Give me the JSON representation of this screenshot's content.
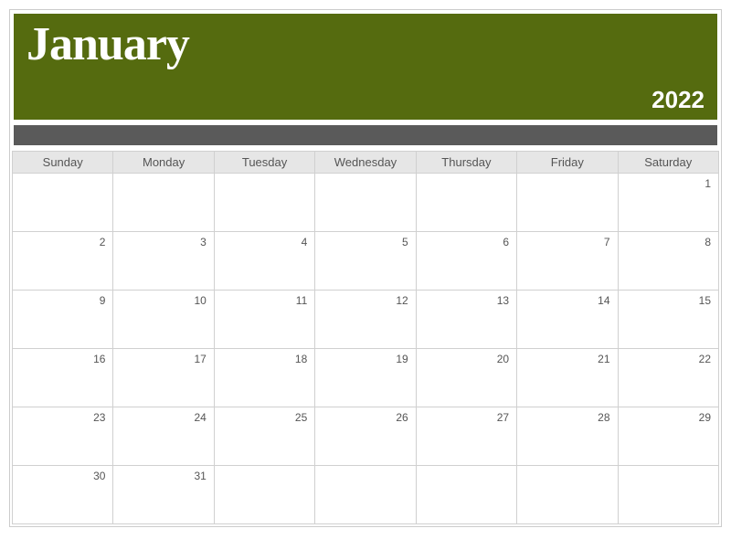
{
  "header": {
    "month": "January",
    "year": "2022"
  },
  "weekdays": [
    "Sunday",
    "Monday",
    "Tuesday",
    "Wednesday",
    "Thursday",
    "Friday",
    "Saturday"
  ],
  "weeks": [
    [
      "",
      "",
      "",
      "",
      "",
      "",
      "1"
    ],
    [
      "2",
      "3",
      "4",
      "5",
      "6",
      "7",
      "8"
    ],
    [
      "9",
      "10",
      "11",
      "12",
      "13",
      "14",
      "15"
    ],
    [
      "16",
      "17",
      "18",
      "19",
      "20",
      "21",
      "22"
    ],
    [
      "23",
      "24",
      "25",
      "26",
      "27",
      "28",
      "29"
    ],
    [
      "30",
      "31",
      "",
      "",
      "",
      "",
      ""
    ]
  ]
}
